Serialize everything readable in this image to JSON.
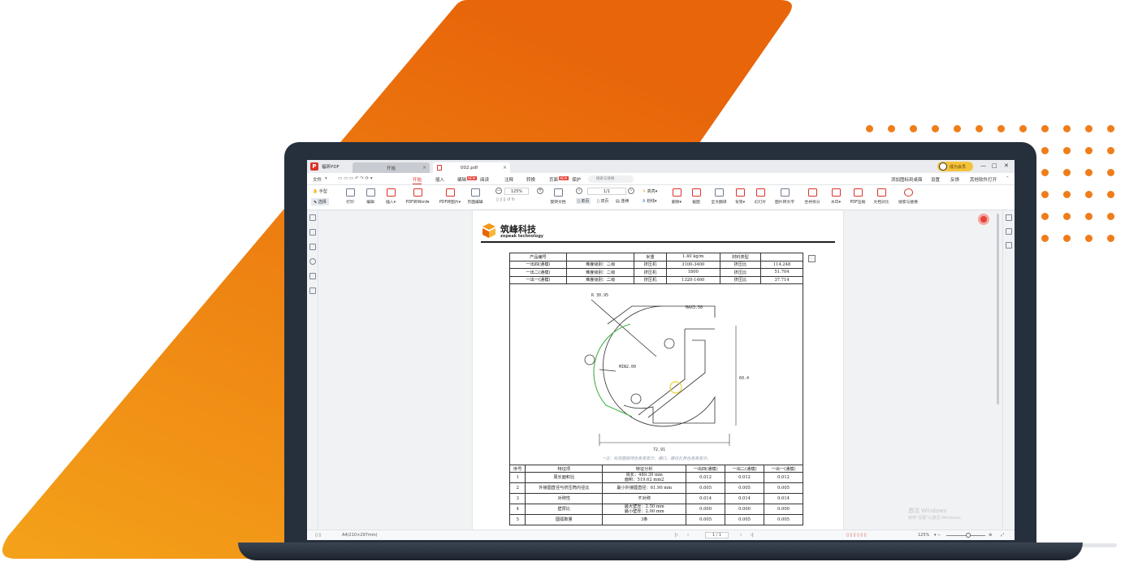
{
  "brand": {
    "orange": "#ef7d1a",
    "red": "#d9342b"
  },
  "app": {
    "name": "福昕PDF",
    "tabs": [
      {
        "label": "开始"
      },
      {
        "label": "002.pdf"
      }
    ],
    "vip_label": "成为会员",
    "window_controls": [
      "—",
      "□",
      "✕"
    ]
  },
  "menu": {
    "file": "文件",
    "items": [
      "开始",
      "插入",
      "编辑",
      "阅读",
      "注释",
      "转换",
      "页面",
      "保护"
    ],
    "new_badge": "NEW",
    "search_placeholder": "搜索与替换",
    "right_items": [
      "添加图标到桌面",
      "设置",
      "反馈",
      "其他软件打开"
    ]
  },
  "toolbar": {
    "hand": "手型",
    "select": "选择",
    "print": "打印",
    "edit": "编辑",
    "insert": "插入",
    "pdf_to_word": "PDF转Word",
    "pdf_to_image": "PDF转图片",
    "page_edit": "页面编辑",
    "zoom": "125%",
    "rotate_doc": "旋转文档",
    "page_indicator": "1/1",
    "single": "单页",
    "double": "双页",
    "continuous": "连续",
    "highlight": "高亮",
    "underline": "划线",
    "delete": "删除",
    "screenshot": "截图",
    "full_translate": "全文翻译",
    "background": "背景",
    "slideshow": "幻灯片",
    "image_to_text": "图片转文字",
    "merge_split": "合并拆分",
    "watermark": "水印",
    "pdf_compress": "PDF压缩",
    "compare": "文档对比",
    "search_replace": "搜索与替换"
  },
  "document": {
    "company_cn": "筑峰科技",
    "company_en": "zopeak technology",
    "table1": {
      "rows": [
        [
          "产品编号",
          "",
          "米重",
          "1.40 kg/m",
          "材料类型",
          ""
        ],
        [
          "一出四(通模)",
          "难度级别：二级",
          "挤压机",
          "3100-3400",
          "挤压比",
          "114.248"
        ],
        [
          "一出二(通模)",
          "难度级别：二级",
          "挤压机",
          "1800",
          "挤压比",
          "51.704"
        ],
        [
          "一出一(通模)",
          "难度级别：二级",
          "挤压机",
          "1320-1460",
          "挤压比",
          "37.714"
        ]
      ]
    },
    "drawing_labels": {
      "radius": "R 30.95",
      "max": "MAX3.50",
      "min": "MIN2.00",
      "height": "60.4",
      "width": "72.91"
    },
    "note": "*注：有效圆弧绿色高亮显示，槽口、螺纹孔黄色高亮显示。",
    "table2": {
      "header": [
        "序号",
        "特征项",
        "特征分析",
        "一出四(通模)",
        "一出二(通模)",
        "一出一(通模)"
      ],
      "rows": [
        [
          "1",
          "周长面积比",
          "周长：489.39 mm\n面积：519.62 mm2",
          "0.012",
          "0.012",
          "0.012"
        ],
        [
          "2",
          "外接圆直径与挤压筒内径比",
          "最小外接圆直径：61.90 mm",
          "0.005",
          "0.005",
          "0.005"
        ],
        [
          "3",
          "对称性",
          "不对称",
          "0.014",
          "0.014",
          "0.014"
        ],
        [
          "4",
          "壁厚比",
          "最大壁厚：2.50 mm\n最小壁厚：2.00 mm",
          "0.000",
          "0.000",
          "0.000"
        ],
        [
          "5",
          "圆弧数量",
          "3条",
          "0.005",
          "0.005",
          "0.005"
        ]
      ]
    }
  },
  "statusbar": {
    "page_size": "A4(210×297mm)",
    "page": "1 / 1",
    "zoom": "125%"
  },
  "watermark": {
    "line1": "激活 Windows",
    "line2": "转到\"设置\"以激活 Windows。"
  }
}
